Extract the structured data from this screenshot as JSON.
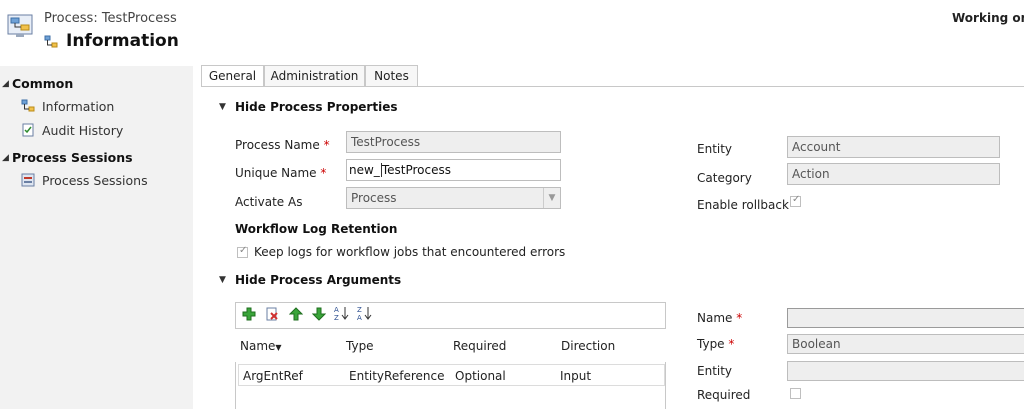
{
  "header": {
    "subtitle": "Process: TestProcess",
    "title": "Information",
    "status": "Working on s"
  },
  "nav": {
    "common": "Common",
    "items": [
      "Information",
      "Audit History"
    ],
    "sessions_head": "Process Sessions",
    "sessions_item": "Process Sessions"
  },
  "tabs": [
    "General",
    "Administration",
    "Notes"
  ],
  "props": {
    "section": "Hide Process Properties",
    "process_name_label": "Process Name",
    "process_name_value": "TestProcess",
    "unique_name_label": "Unique Name",
    "unique_prefix": "new_",
    "unique_value": "TestProcess",
    "activate_label": "Activate As",
    "activate_value": "Process",
    "log_heading": "Workflow Log Retention",
    "log_checkbox": "Keep logs for workflow jobs that encountered errors",
    "entity_label": "Entity",
    "entity_value": "Account",
    "category_label": "Category",
    "category_value": "Action",
    "rollback_label": "Enable rollback"
  },
  "args": {
    "section": "Hide Process Arguments",
    "columns": [
      "Name",
      "Type",
      "Required",
      "Direction"
    ],
    "row": [
      "ArgEntRef",
      "EntityReference",
      "Optional",
      "Input"
    ],
    "name_label": "Name",
    "type_label": "Type",
    "type_value": "Boolean",
    "entity_label": "Entity",
    "required_label": "Required"
  },
  "colors": {
    "nav_bg": "#f2f2f2",
    "required": "#cc0000",
    "field_bg": "#eeeeee"
  }
}
